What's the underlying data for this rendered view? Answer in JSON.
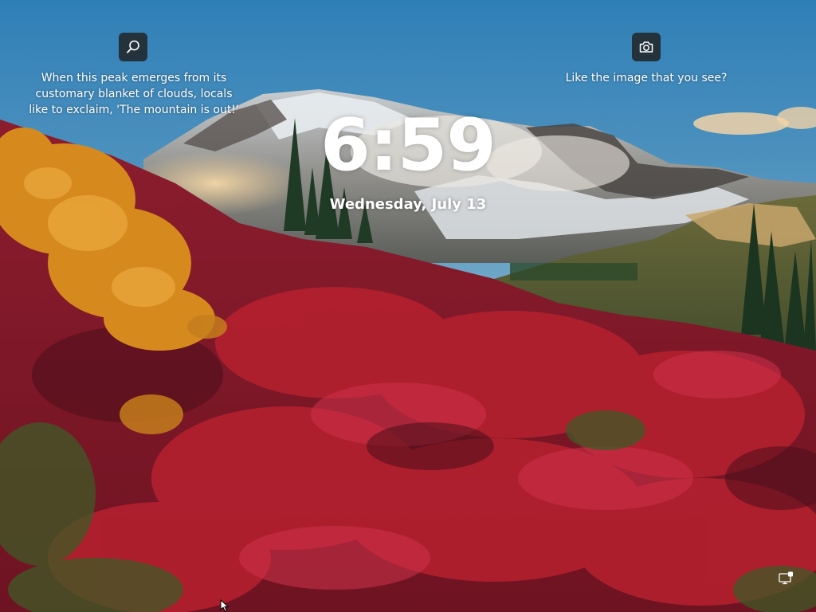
{
  "screen": "windows-lock-screen",
  "clock": {
    "time": "6:59",
    "date": "Wednesday, July 13"
  },
  "spotlight": {
    "left_icon": "search-icon",
    "left_caption": "When this peak emerges from its\ncustomary blanket of clouds, locals\nlike to exclaim, 'The mountain is out!'",
    "right_icon": "camera-icon",
    "right_caption": "Like the image that you see?"
  },
  "status": {
    "network_icon": "network-icon"
  },
  "colors": {
    "sky": "#3d86b8",
    "foliage_red": "#a3192e",
    "foliage_orange": "#d8891c",
    "button_bg": "#202020",
    "text": "#ffffff"
  }
}
